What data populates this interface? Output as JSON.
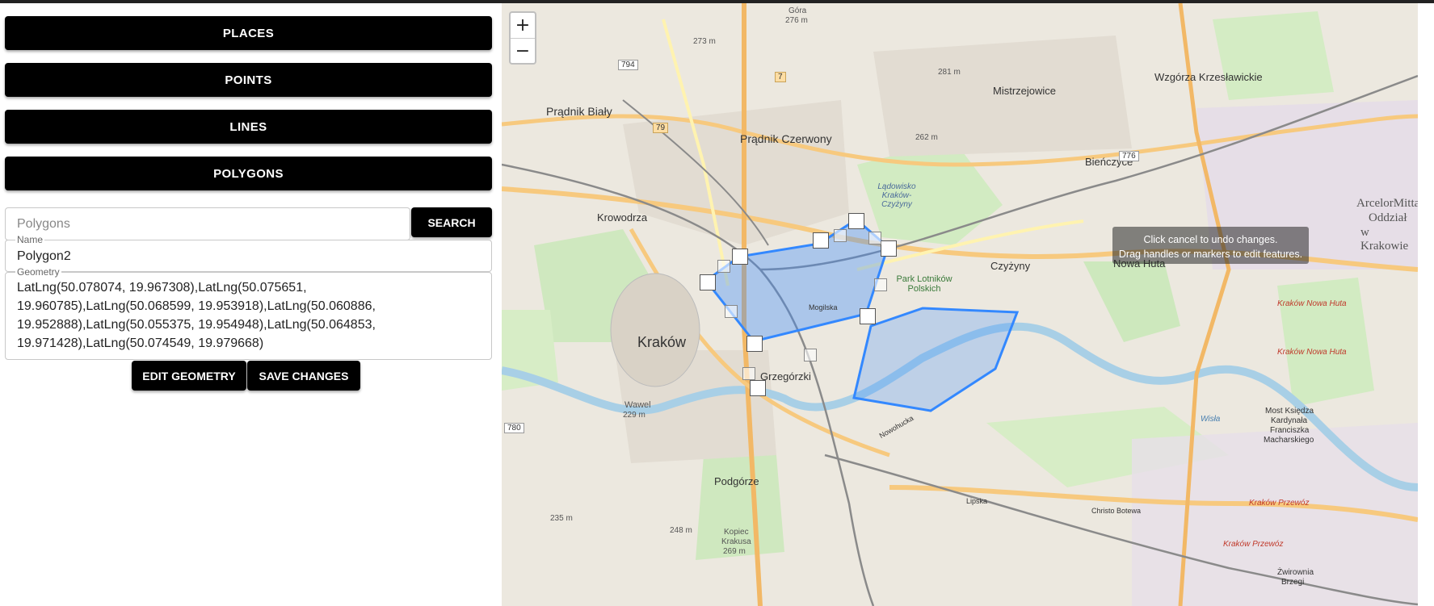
{
  "sidebar": {
    "buttons": [
      "PLACES",
      "POINTS",
      "LINES",
      "POLYGONS"
    ]
  },
  "search": {
    "placeholder": "Polygons",
    "button_label": "SEARCH"
  },
  "form": {
    "name_label": "Name",
    "name_value": "Polygon2",
    "geometry_label": "Geometry",
    "geometry_value": "LatLng(50.078074, 19.967308),LatLng(50.075651, 19.960785),LatLng(50.068599, 19.953918),LatLng(50.060886, 19.952888),LatLng(50.055375, 19.954948),LatLng(50.064853, 19.971428),LatLng(50.074549, 19.979668)",
    "edit_label": "EDIT GEOMETRY",
    "save_label": "SAVE CHANGES"
  },
  "map": {
    "zoom_in": "+",
    "zoom_out": "−",
    "tooltip_line1": "Click cancel to undo changes.",
    "tooltip_line2": "Drag handles or markers to edit features.",
    "labels": {
      "krakow": "Kraków",
      "pradnik_bialy": "Prądnik Biały",
      "pradnik_czerwony": "Prądnik Czerwony",
      "krowodrza": "Krowodrza",
      "mistrzejowice": "Mistrzejowice",
      "bienczyce": "Bieńczyce",
      "wzgorza": "Wzgórza Krzesławickie",
      "czyzyny": "Czyżyny",
      "nowa_huta": "Nowa Huta",
      "grzegorzki": "Grzegórzki",
      "podgorze": "Podgórze",
      "wawel": "Wawel",
      "arcelor1": "ArcelorMittal",
      "arcelor2": "Oddział",
      "arcelor3": "w Krakowie",
      "park": "Park Lotników Polskich",
      "lotnisko": "Lądowisko Kraków-Czyżyny",
      "most1": "Most Księdza",
      "most2": "Kardynała",
      "most3": "Franciszka",
      "most4": "Macharskiego",
      "mogilska": "Mogilska",
      "nowohucka": "Nowohucka",
      "lipska": "Lipska",
      "christo": "Christo Botewa",
      "wisla": "Wisła",
      "kopiec1": "Kopiec",
      "kopiec2": "Krakusa",
      "kopiec3": "269 m",
      "gora": "Góra",
      "gora_m": "276 m",
      "m273": "273 m",
      "m281": "281 m",
      "m262": "262 m",
      "m235": "235 m",
      "m248": "248 m",
      "wawel_m": "229 m",
      "krakow_nh1": "Kraków Nowa Huta",
      "krakow_nh2": "Kraków Nowa Huta",
      "krakow_przewoz1": "Kraków Przewóz",
      "krakow_przewoz2": "Kraków Przewóz",
      "zwirownia1": "Żwirownia",
      "zwirownia2": "Brzegi",
      "road794": "794",
      "road7": "7",
      "road79": "79",
      "road776": "776",
      "road780": "780"
    }
  }
}
